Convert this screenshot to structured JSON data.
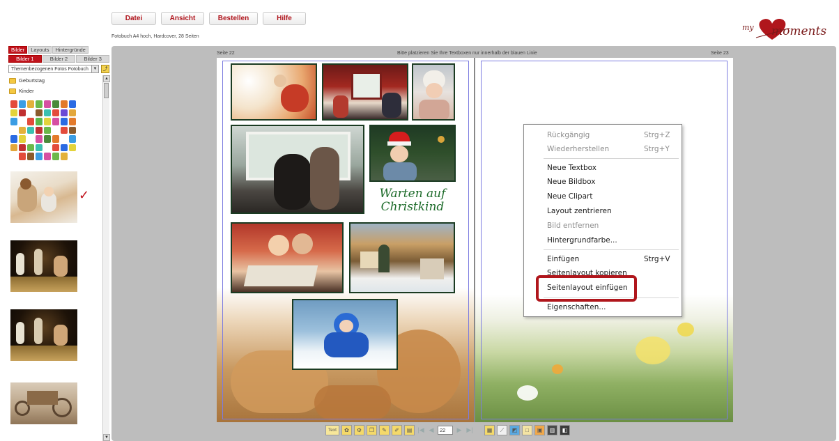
{
  "menu": {
    "items": [
      {
        "label": "Datei"
      },
      {
        "label": "Ansicht"
      },
      {
        "label": "Bestellen"
      },
      {
        "label": "Hilfe"
      }
    ]
  },
  "product_info": "Fotobuch A4 hoch, Hardcover, 28 Seiten",
  "logo": {
    "prefix": "my",
    "name": "moments"
  },
  "sidebar": {
    "tabs": [
      "Bilder",
      "Layouts",
      "Hintergründe"
    ],
    "subtabs": [
      "Bilder 1",
      "Bilder 2",
      "Bilder 3"
    ],
    "combo_value": "Themenbezogenen Fotos Fotobuch",
    "folders": [
      "Geburtstag",
      "Kinder"
    ]
  },
  "workspace": {
    "left_page_label": "Seite 22",
    "right_page_label": "Seite 23",
    "hint": "Bitte platzieren Sie Ihre Textboxen nur innerhalb der blauen Linie",
    "handwriting_line1": "Warten auf",
    "handwriting_line2": "Christkind"
  },
  "context_menu": {
    "undo": {
      "label": "Rückgängig",
      "shortcut": "Strg+Z"
    },
    "redo": {
      "label": "Wiederherstellen",
      "shortcut": "Strg+Y"
    },
    "new_textbox": "Neue Textbox",
    "new_imagebox": "Neue Bildbox",
    "new_clipart": "Neue Clipart",
    "center_layout": "Layout zentrieren",
    "remove_image": "Bild entfernen",
    "background_color": "Hintergrundfarbe...",
    "paste": {
      "label": "Einfügen",
      "shortcut": "Strg+V"
    },
    "copy_layout": "Seitenlayout kopieren",
    "paste_layout": "Seitenlayout einfügen",
    "properties": "Eigenschaften..."
  },
  "toolbar": {
    "text_button": "Text",
    "page_number": "22"
  },
  "colors": {
    "accent_red": "#c0121c",
    "workspace_gray": "#bdbdbd",
    "photo_border": "#1b3b22",
    "handwriting_green": "#1d6b2a"
  }
}
